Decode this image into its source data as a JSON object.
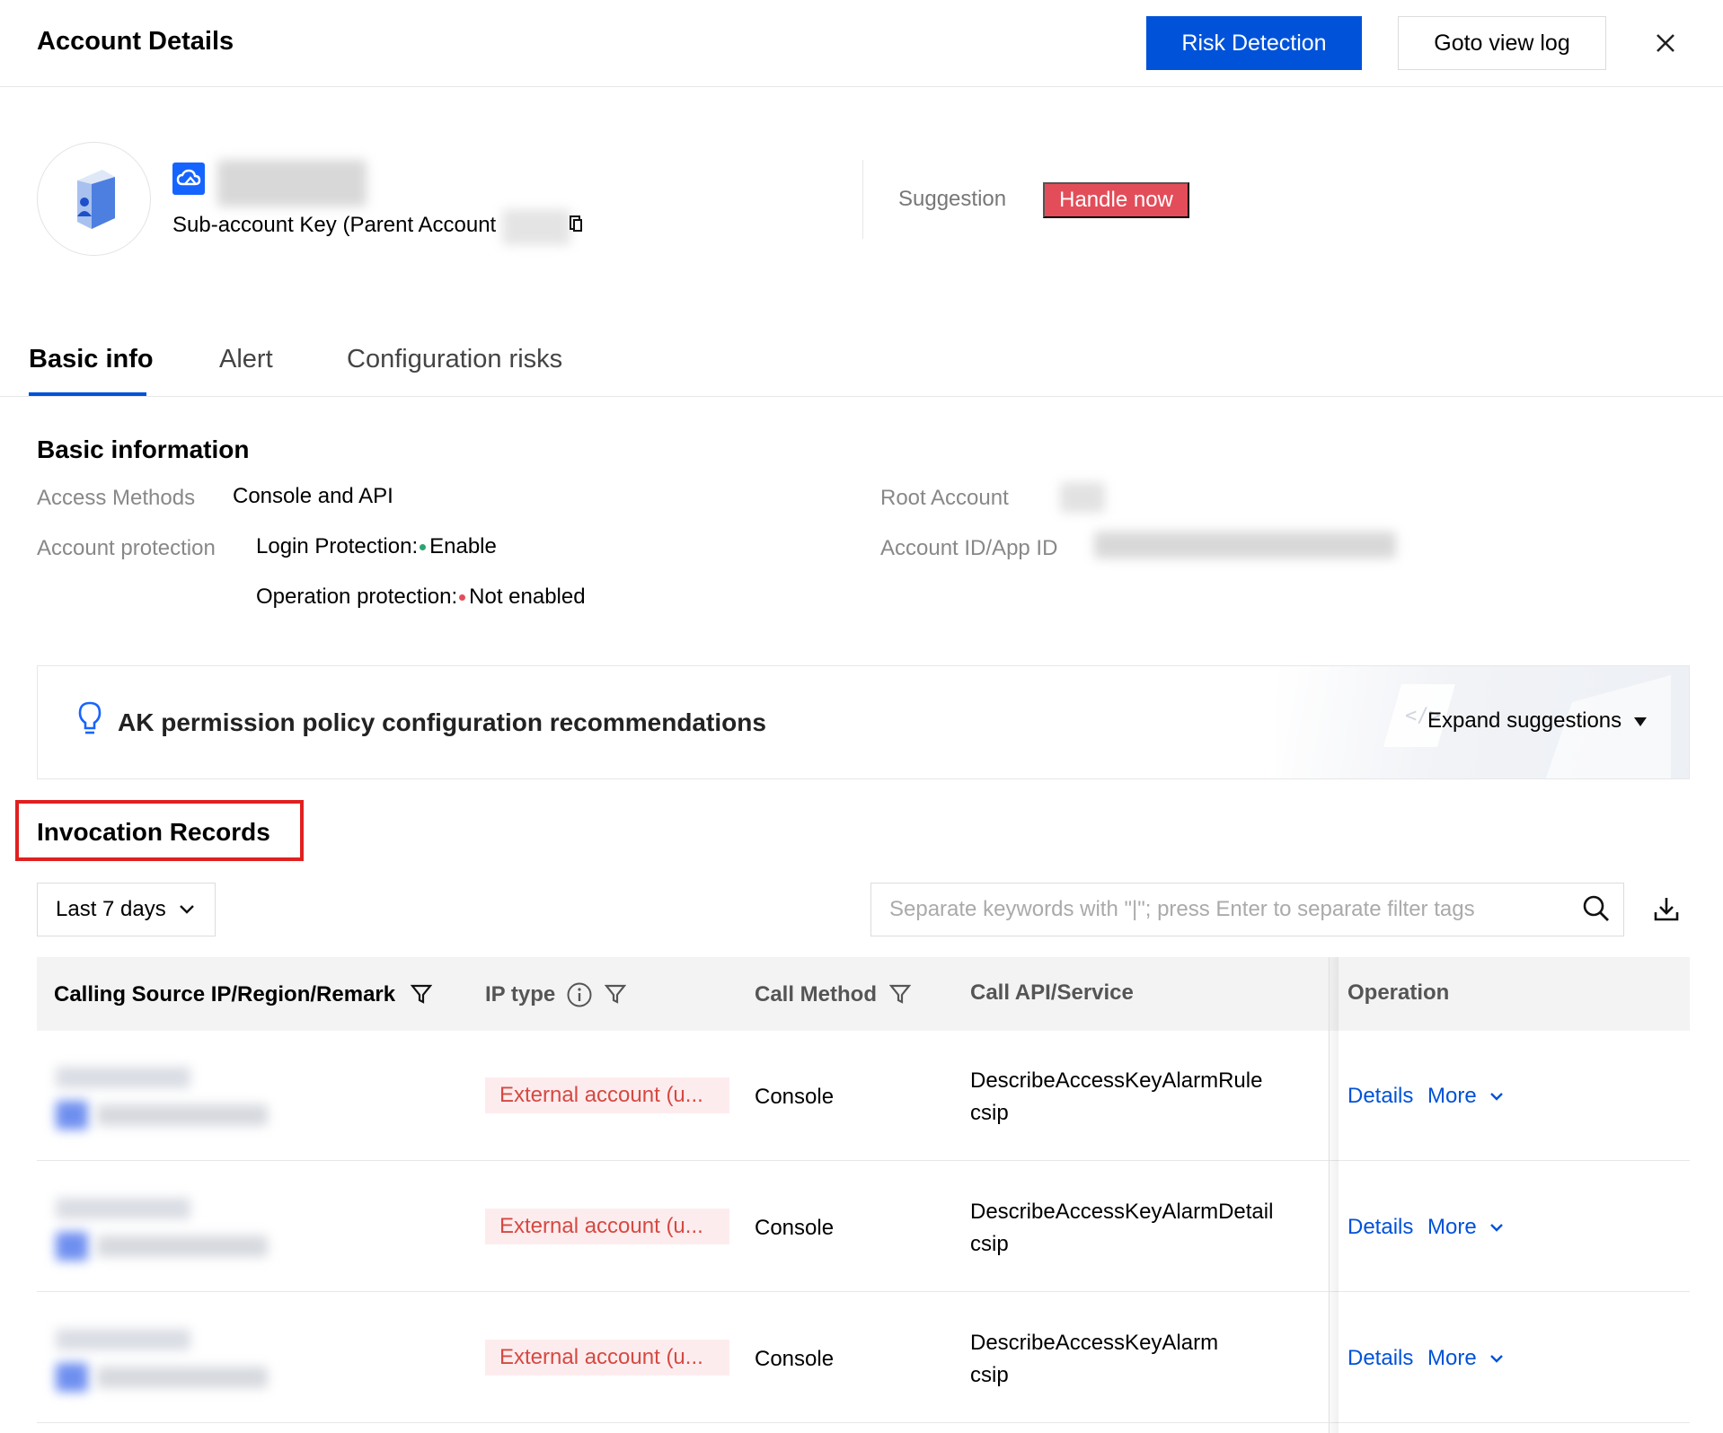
{
  "header": {
    "title": "Account Details",
    "risk_detection_label": "Risk Detection",
    "view_log_label": "Goto view log"
  },
  "profile": {
    "account_type": "Sub-account Key (Parent Account",
    "suggestion_label": "Suggestion",
    "handle_now_label": "Handle now"
  },
  "tabs": [
    {
      "label": "Basic info",
      "active": true
    },
    {
      "label": "Alert",
      "active": false
    },
    {
      "label": "Configuration risks",
      "active": false
    }
  ],
  "basic_info": {
    "title": "Basic information",
    "access_methods_label": "Access Methods",
    "access_methods_value": "Console and API",
    "account_protection_label": "Account protection",
    "login_protection_label": "Login Protection:",
    "login_protection_value": "Enable",
    "operation_protection_label": "Operation protection:",
    "operation_protection_value": "Not enabled",
    "root_account_label": "Root Account",
    "account_id_label": "Account ID/App ID"
  },
  "recommendation": {
    "text": "AK permission policy configuration recommendations",
    "expand_label": "Expand suggestions"
  },
  "invocation": {
    "title": "Invocation Records",
    "time_range": "Last 7 days",
    "search_placeholder": "Separate keywords with \"|\"; press Enter to separate filter tags",
    "columns": {
      "source": "Calling Source IP/Region/Remark",
      "ip_type": "IP type",
      "call_method": "Call Method",
      "call_api": "Call API/Service",
      "operation": "Operation"
    },
    "rows": [
      {
        "ip_type": "External account (u...",
        "call_method": "Console",
        "api": "DescribeAccessKeyAlarmRule",
        "service": "csip",
        "details": "Details",
        "more": "More"
      },
      {
        "ip_type": "External account (u...",
        "call_method": "Console",
        "api": "DescribeAccessKeyAlarmDetail",
        "service": "csip",
        "details": "Details",
        "more": "More"
      },
      {
        "ip_type": "External account (u...",
        "call_method": "Console",
        "api": "DescribeAccessKeyAlarm",
        "service": "csip",
        "details": "Details",
        "more": "More"
      }
    ]
  },
  "colors": {
    "primary": "#0052d9",
    "danger": "#e34d59",
    "tag_text": "#d54941",
    "tag_bg": "#fdecee",
    "success_dot": "#2ba471",
    "error_dot": "#e34d59",
    "highlight_border": "#e02020"
  },
  "icons": [
    "close-icon",
    "cloud-icon",
    "copy-icon",
    "bulb-icon",
    "caret-down-icon",
    "chevron-down-icon",
    "search-icon",
    "download-icon",
    "filter-icon",
    "info-icon"
  ]
}
